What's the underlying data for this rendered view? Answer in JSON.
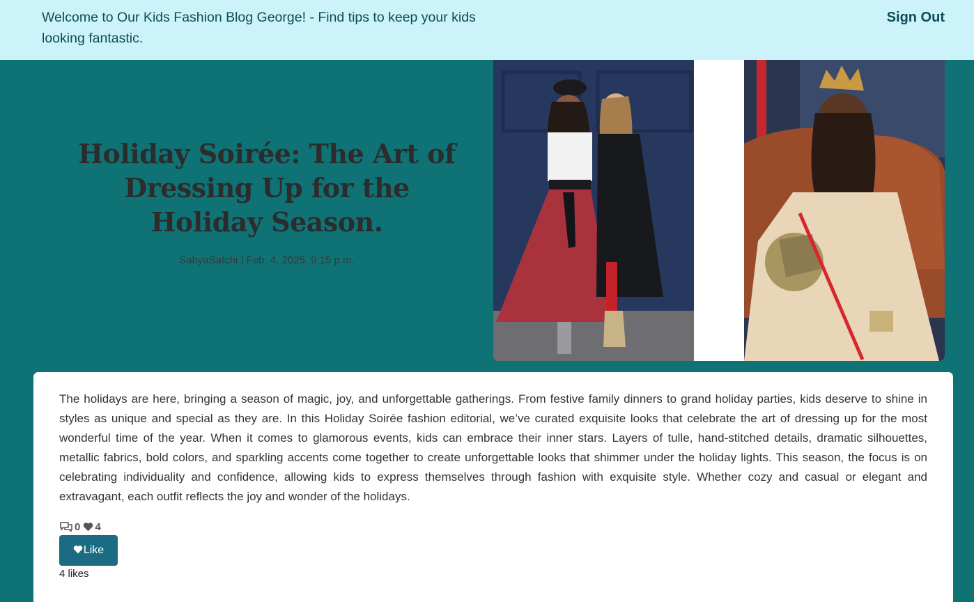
{
  "header": {
    "welcome_text": "Welcome to Our Kids Fashion Blog George! - Find tips to keep your kids looking fantastic.",
    "sign_out_label": "Sign Out"
  },
  "post": {
    "title": "Holiday Soirée: The Art of Dressing Up for the Holiday Season.",
    "meta": "SabyaSatchi | Feb. 4, 2025, 9:15 p.m.",
    "hero_image_icon": "photo-collage",
    "body": "The holidays are here, bringing a season of magic, joy, and unforgettable gatherings. From festive family dinners to grand holiday parties, kids deserve to shine in styles as unique and special as they are. In this Holiday Soirée fashion editorial, we’ve curated exquisite looks that celebrate the art of dressing up for the most wonderful time of the year. When it comes to glamorous events, kids can embrace their inner stars. Layers of tulle, hand-stitched details, dramatic silhouettes, metallic fabrics, bold colors, and sparkling accents come together to create unforgettable looks that shimmer under the holiday lights. This season, the focus is on celebrating individuality and confidence, allowing kids to express themselves through fashion with exquisite style. Whether cozy and casual or elegant and extravagant, each outfit reflects the joy and wonder of the holidays."
  },
  "stats": {
    "comments_icon": "comments-icon",
    "comments_count": "0",
    "likes_icon": "heart-icon",
    "likes_count": "4"
  },
  "like_button": {
    "icon": "heart-icon",
    "label": "Like"
  },
  "likes_text": "4 likes",
  "colors": {
    "topbar": "#cdf3fa",
    "page_background": "#0f7376",
    "card": "#ffffff",
    "button": "#1b6c83"
  }
}
